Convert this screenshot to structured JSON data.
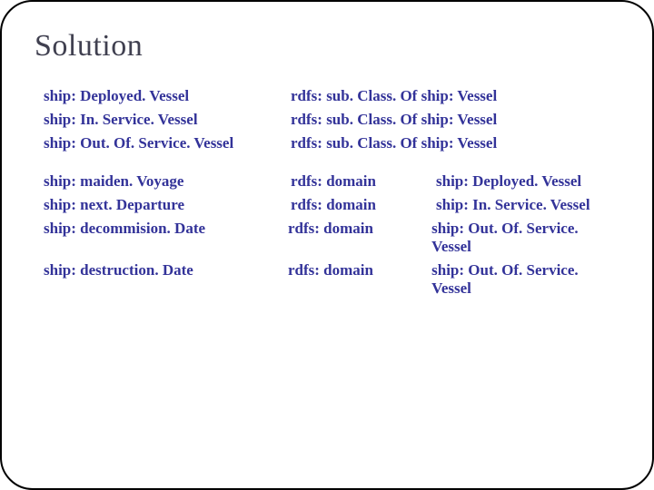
{
  "title": "Solution",
  "group1": [
    {
      "subj": "ship: Deployed. Vessel",
      "pred": "rdfs: sub. Class. Of  ship: Vessel"
    },
    {
      "subj": "ship: In. Service. Vessel",
      "pred": "rdfs: sub. Class. Of  ship: Vessel"
    },
    {
      "subj": "ship: Out. Of. Service. Vessel",
      "pred": "rdfs: sub. Class. Of  ship: Vessel"
    }
  ],
  "group2": [
    {
      "subj": "ship: maiden. Voyage",
      "pred": "rdfs: domain",
      "obj": "ship: Deployed. Vessel"
    },
    {
      "subj": "ship: next. Departure",
      "pred": "rdfs: domain",
      "obj": "ship: In. Service. Vessel"
    },
    {
      "subj": "ship: decommision. Date",
      "pred": "rdfs: domain",
      "obj": "ship: Out. Of. Service. Vessel"
    },
    {
      "subj": "ship: destruction. Date",
      "pred": "rdfs: domain",
      "obj": "ship: Out. Of. Service. Vessel"
    }
  ]
}
